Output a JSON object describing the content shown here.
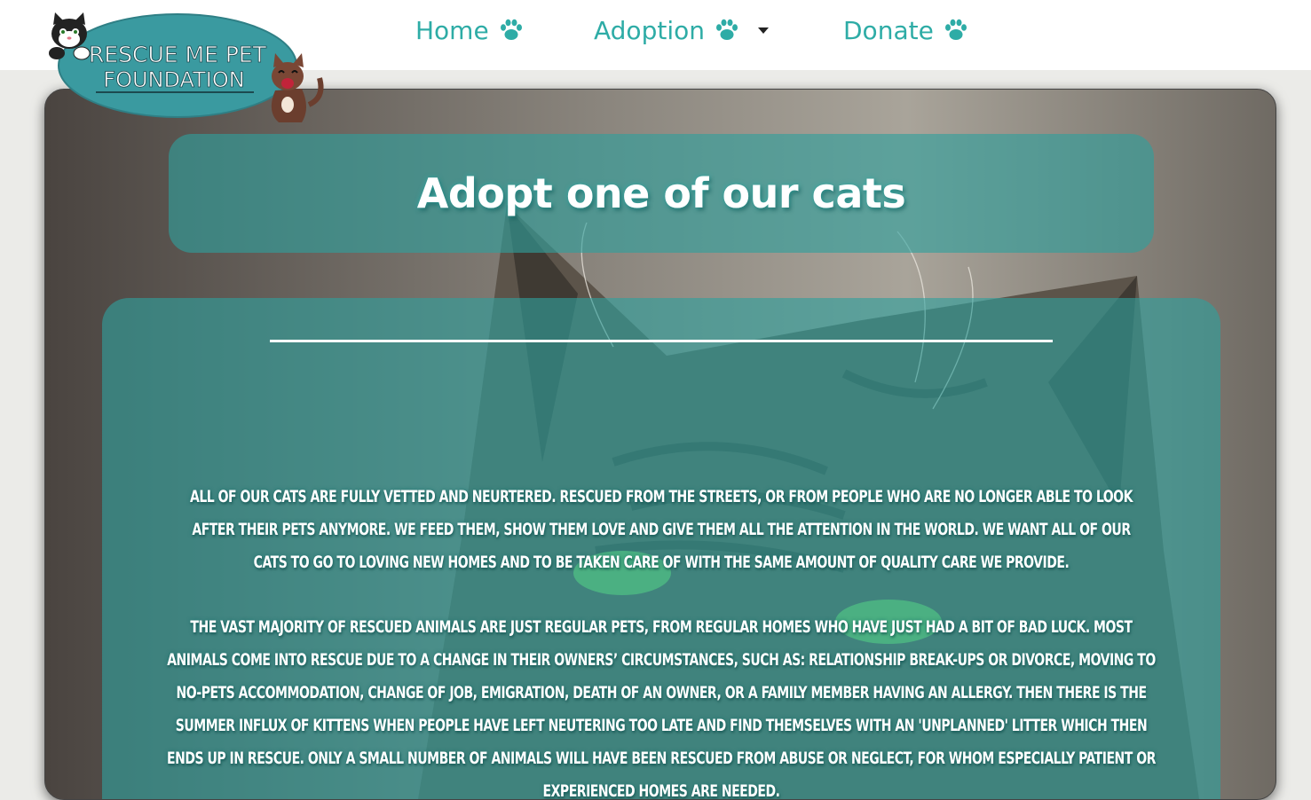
{
  "nav": {
    "home_label": "Home",
    "adoption_label": "Adoption",
    "donate_label": "Donate"
  },
  "logo": {
    "line1": "RESCUE ME PET",
    "line2": "FOUNDATION"
  },
  "icons": {
    "nav_item_icon": "paw-icon",
    "dropdown_icon": "caret-down-icon",
    "logo_left": "cat-icon",
    "logo_right": "cat-icon"
  },
  "colors": {
    "accent": "#2eaca6",
    "panel_overlay": "#2ea09c",
    "page_bg": "#ebebe8"
  },
  "main": {
    "title": "Adopt one of our cats",
    "paragraph1": "All of our cats are fully vetted and neurtered. Rescued from the streets, or from people who are no longer able to look after their pets anymore. We feed them, show them love and give them all the attention in the world. We want all of our cats to go to loving new homes and to be taken care of with the same amount of quality care we provide.",
    "paragraph2": "The vast majority of rescued animals are just regular pets, from regular homes who have just had a bit of bad luck. Most animals come into rescue due to a change in their owners’ circumstances, such as: relationship break-ups or divorce, moving to no-pets accommodation, change of job, emigration, death of an owner, or a family member having an allergy. Then there is the summer influx of kittens when people have left neutering too late and find themselves with an 'unplanned' litter which then ends up in rescue. Only a small number of animals will have been rescued from abuse or neglect, for whom especially patient or experienced homes are needed."
  }
}
